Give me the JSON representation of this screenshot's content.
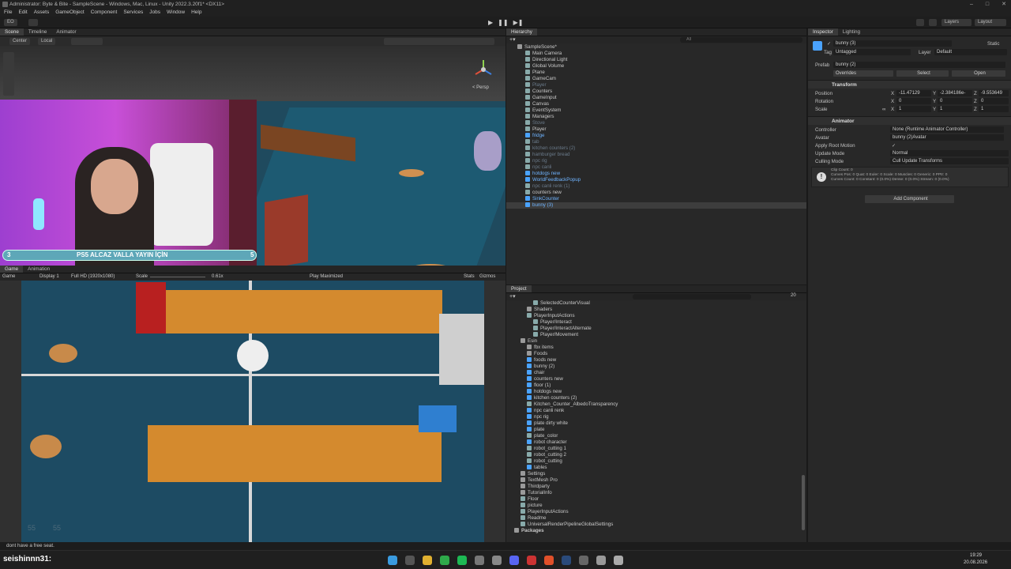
{
  "window": {
    "title": "Administrator: Byte & Bite - SampleScene - Windows, Mac, Linux - Unity 2022.3.20f1* <DX11>"
  },
  "menu": [
    "File",
    "Edit",
    "Assets",
    "GameObject",
    "Component",
    "Services",
    "Jobs",
    "Window",
    "Help"
  ],
  "toolbar": {
    "account": "EO",
    "layers": "Layers",
    "layout": "Layout"
  },
  "scene_tabs": [
    "Scene",
    "Timeline",
    "Animator"
  ],
  "scene_toolbar": {
    "pivot": "Center",
    "space": "Local",
    "persp": "< Persp"
  },
  "game_tabs": [
    "Game",
    "Animation"
  ],
  "game_toolbar": {
    "mode": "Game",
    "display": "Display 1",
    "resolution": "Full HD (1920x1080)",
    "scale_label": "Scale",
    "scale_value": "0.61x",
    "play_mode": "Play Maximized",
    "stats": "Stats",
    "gizmos": "Gizmos"
  },
  "overlay": {
    "left_num": "3",
    "text": "PS5 ALCAZ VALLA YAYIN İÇİN",
    "right_num": "5"
  },
  "game_corner": {
    "a": "55",
    "b": "55"
  },
  "hierarchy": {
    "tab": "Hierarchy",
    "search_placeholder": "All",
    "items": [
      {
        "label": "SampleScene*",
        "kind": "scene",
        "indent": 0
      },
      {
        "label": "Main Camera",
        "kind": "cube",
        "indent": 1
      },
      {
        "label": "Directional Light",
        "kind": "cube",
        "indent": 1
      },
      {
        "label": "Global Volume",
        "kind": "cube",
        "indent": 1
      },
      {
        "label": "Plane",
        "kind": "cube",
        "indent": 1
      },
      {
        "label": "GameCam",
        "kind": "cube",
        "indent": 1
      },
      {
        "label": "Player",
        "kind": "dim",
        "indent": 1
      },
      {
        "label": "Counters",
        "kind": "cube",
        "indent": 1
      },
      {
        "label": "GameInput",
        "kind": "cube",
        "indent": 1
      },
      {
        "label": "Canvas",
        "kind": "cube",
        "indent": 1
      },
      {
        "label": "EventSystem",
        "kind": "cube",
        "indent": 1
      },
      {
        "label": "Managers",
        "kind": "cube",
        "indent": 1
      },
      {
        "label": "Stove",
        "kind": "dim",
        "indent": 1
      },
      {
        "label": "Player",
        "kind": "cube",
        "indent": 1
      },
      {
        "label": "fridge",
        "kind": "prefab",
        "indent": 1
      },
      {
        "label": "tab",
        "kind": "dim",
        "indent": 1
      },
      {
        "label": "kitchen counters (2)",
        "kind": "dim",
        "indent": 1
      },
      {
        "label": "hamburger bread",
        "kind": "dim",
        "indent": 1
      },
      {
        "label": "npc rig",
        "kind": "dim",
        "indent": 1
      },
      {
        "label": "npc canli",
        "kind": "dim",
        "indent": 1
      },
      {
        "label": "hotdogs new",
        "kind": "prefab",
        "indent": 1
      },
      {
        "label": "WorldFeedbackPopup",
        "kind": "prefab",
        "indent": 1
      },
      {
        "label": "npc canli renk (1)",
        "kind": "dim",
        "indent": 1
      },
      {
        "label": "counters new",
        "kind": "cube",
        "indent": 1
      },
      {
        "label": "SinkCounter",
        "kind": "prefab",
        "indent": 1
      },
      {
        "label": "bunny (3)",
        "kind": "prefab",
        "indent": 1,
        "selected": true
      }
    ]
  },
  "project": {
    "tab": "Project",
    "count": "20",
    "items": [
      {
        "label": "SelectedCounterVisual",
        "kind": "file",
        "indent": 3
      },
      {
        "label": "Shaders",
        "kind": "folder",
        "indent": 2
      },
      {
        "label": "PlayerInputActions",
        "kind": "file",
        "indent": 2
      },
      {
        "label": "Player/Interact",
        "kind": "file",
        "indent": 3
      },
      {
        "label": "Player/InteractAlternate",
        "kind": "file",
        "indent": 3
      },
      {
        "label": "Player/Movement",
        "kind": "file",
        "indent": 3
      },
      {
        "label": "Esin",
        "kind": "folder",
        "indent": 1
      },
      {
        "label": "fbx items",
        "kind": "folder",
        "indent": 2
      },
      {
        "label": "Foods",
        "kind": "folder",
        "indent": 2
      },
      {
        "label": "foods new",
        "kind": "prefab",
        "indent": 2
      },
      {
        "label": "bunny (2)",
        "kind": "prefab",
        "indent": 2
      },
      {
        "label": "chair",
        "kind": "prefab",
        "indent": 2
      },
      {
        "label": "counters new",
        "kind": "prefab",
        "indent": 2
      },
      {
        "label": "floor (1)",
        "kind": "prefab",
        "indent": 2
      },
      {
        "label": "hotdogs new",
        "kind": "prefab",
        "indent": 2
      },
      {
        "label": "kitchen counters (2)",
        "kind": "prefab",
        "indent": 2
      },
      {
        "label": "Kitchen_Counter_AlbedoTransparency",
        "kind": "file",
        "indent": 2
      },
      {
        "label": "npc canli renk",
        "kind": "prefab",
        "indent": 2
      },
      {
        "label": "npc rig",
        "kind": "prefab",
        "indent": 2
      },
      {
        "label": "plate dirty white",
        "kind": "prefab",
        "indent": 2
      },
      {
        "label": "plate",
        "kind": "prefab",
        "indent": 2
      },
      {
        "label": "plate_color",
        "kind": "file",
        "indent": 2
      },
      {
        "label": "robot character",
        "kind": "prefab",
        "indent": 2
      },
      {
        "label": "robot_cutting 1",
        "kind": "file",
        "indent": 2
      },
      {
        "label": "robot_cutting 2",
        "kind": "file",
        "indent": 2
      },
      {
        "label": "robot_cutting",
        "kind": "file",
        "indent": 2
      },
      {
        "label": "tables",
        "kind": "prefab",
        "indent": 2
      },
      {
        "label": "Settings",
        "kind": "folder",
        "indent": 1
      },
      {
        "label": "TextMesh Pro",
        "kind": "folder",
        "indent": 1
      },
      {
        "label": "Thirdparty",
        "kind": "folder",
        "indent": 1
      },
      {
        "label": "TutorialInfo",
        "kind": "folder",
        "indent": 1
      },
      {
        "label": "Floor",
        "kind": "file",
        "indent": 1
      },
      {
        "label": "picture",
        "kind": "file",
        "indent": 1
      },
      {
        "label": "PlayerInputActions",
        "kind": "file",
        "indent": 1
      },
      {
        "label": "Readme",
        "kind": "file",
        "indent": 1
      },
      {
        "label": "UniversalRenderPipelineGlobalSettings",
        "kind": "file",
        "indent": 1
      },
      {
        "label": "Packages",
        "kind": "folder",
        "indent": 0
      }
    ]
  },
  "inspector": {
    "tabs": [
      "Inspector",
      "Lighting"
    ],
    "name": "bunny (3)",
    "static": "Static",
    "tag_label": "Tag",
    "tag": "Untagged",
    "layer_label": "Layer",
    "layer": "Default",
    "prefab_label": "Prefab",
    "prefab": "bunny (2)",
    "overrides": "Overrides",
    "select": "Select",
    "open": "Open",
    "transform": {
      "header": "Transform",
      "position_label": "Position",
      "pos": {
        "x": "-11.47129",
        "y": "-2.384186e-",
        "z": "-9.553649"
      },
      "rotation_label": "Rotation",
      "rot": {
        "x": "0",
        "y": "0",
        "z": "0"
      },
      "scale_label": "Scale",
      "scale": {
        "x": "1",
        "y": "1",
        "z": "1"
      }
    },
    "animator": {
      "header": "Animator",
      "controller_label": "Controller",
      "controller": "None (Runtime Animator Controller)",
      "avatar_label": "Avatar",
      "avatar": "bunny (2)Avatar",
      "root_label": "Apply Root Motion",
      "root": "✓",
      "update_label": "Update Mode",
      "update": "Normal",
      "culling_label": "Culling Mode",
      "culling": "Cull Update Transforms",
      "info1": "Clip Count: 0",
      "info2": "Curves Pos: 0 Quat: 0 Euler: 0 Scale: 0 Muscles: 0 Generic: 0 PPtr: 0",
      "info3": "Curves Count: 0 Constant: 0 (0.0%) Dense: 0 (0.0%) Stream: 0 (0.0%)"
    },
    "add_component": "Add Component"
  },
  "status": {
    "message": "dont have a free seat."
  },
  "taskbar": {
    "user": "seishinnn31:",
    "time": "19:29",
    "date": "20.08.2026"
  }
}
